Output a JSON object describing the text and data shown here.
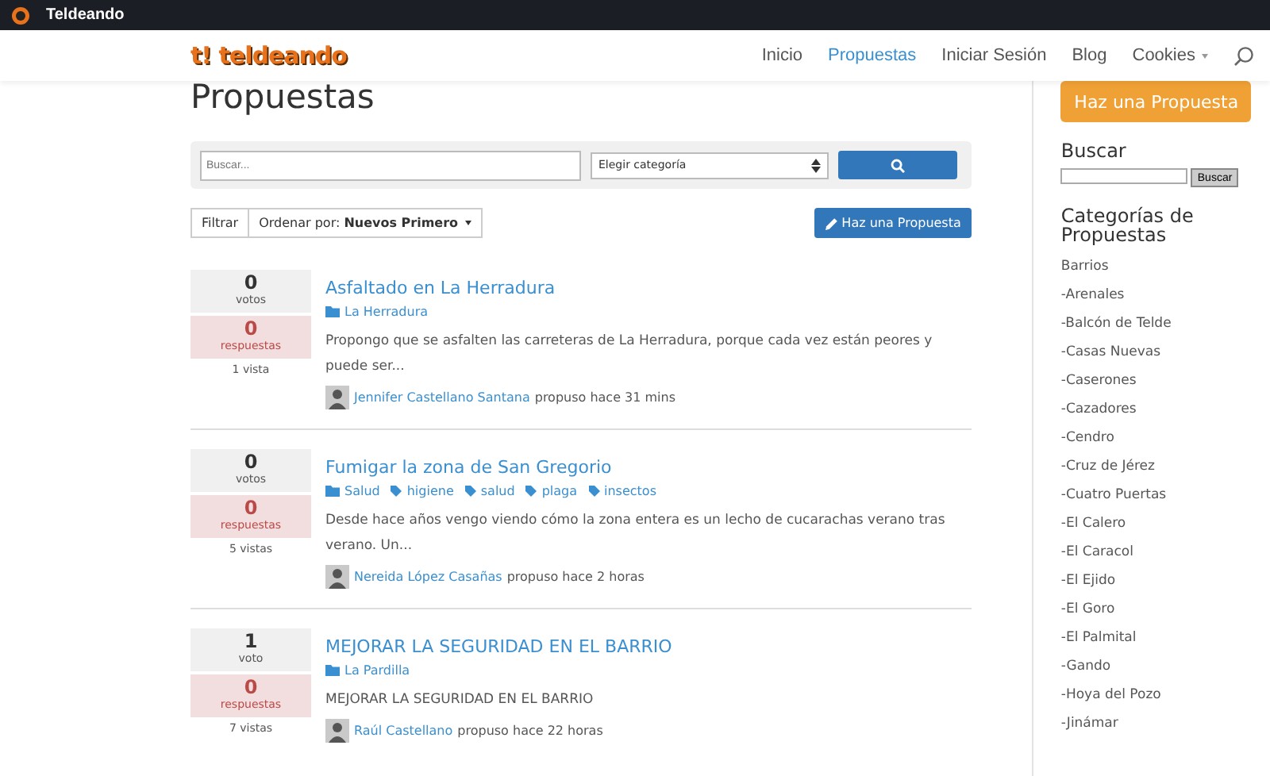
{
  "window": {
    "title": "Teldeando"
  },
  "header": {
    "logo": "t! teldeando",
    "nav": [
      {
        "label": "Inicio",
        "selected": false,
        "dropdown": false
      },
      {
        "label": "Propuestas",
        "selected": true,
        "dropdown": false
      },
      {
        "label": "Iniciar Sesión",
        "selected": false,
        "dropdown": false
      },
      {
        "label": "Blog",
        "selected": false,
        "dropdown": false
      },
      {
        "label": "Cookies",
        "selected": false,
        "dropdown": true
      }
    ]
  },
  "page": {
    "title": "Propuestas",
    "filter_bar": {
      "search_placeholder": "Buscar...",
      "category_select": "Elegir categoría"
    },
    "toolbar": {
      "filter": "Filtrar",
      "sort_label": "Ordenar por:",
      "sort_value": "Nuevos Primero",
      "new_button": "Haz una Propuesta"
    },
    "proposals": [
      {
        "votes": "0",
        "votes_label": "votos",
        "answers": "0",
        "answers_label": "respuestas",
        "views": "1 vista",
        "title": "Asfaltado en La Herradura",
        "terms": [
          {
            "kind": "category",
            "label": "La Herradura"
          }
        ],
        "excerpt": "Propongo que se asfalten las carreteras de La Herradura, porque cada vez están peores y puede ser...",
        "author": "Jennifer Castellano Santana",
        "meta": "propuso hace 31 mins"
      },
      {
        "votes": "0",
        "votes_label": "votos",
        "answers": "0",
        "answers_label": "respuestas",
        "views": "5 vistas",
        "title": "Fumigar la zona de San Gregorio",
        "terms": [
          {
            "kind": "category",
            "label": "Salud"
          },
          {
            "kind": "tag",
            "label": "higiene"
          },
          {
            "kind": "tag",
            "label": "salud"
          },
          {
            "kind": "tag",
            "label": "plaga"
          },
          {
            "kind": "tag",
            "label": "insectos"
          }
        ],
        "excerpt": "Desde hace años vengo viendo cómo la zona entera es un lecho de cucarachas verano tras verano. Un...",
        "author": "Nereida López Casañas",
        "meta": "propuso hace 2 horas"
      },
      {
        "votes": "1",
        "votes_label": "voto",
        "answers": "0",
        "answers_label": "respuestas",
        "views": "7 vistas",
        "title": "MEJORAR LA SEGURIDAD EN EL BARRIO",
        "terms": [
          {
            "kind": "category",
            "label": "La Pardilla"
          }
        ],
        "excerpt": "MEJORAR LA SEGURIDAD EN EL BARRIO",
        "author": "Raúl Castellano",
        "meta": "propuso hace 22 horas"
      }
    ]
  },
  "sidebar": {
    "cta": "Haz una Propuesta",
    "search_title": "Buscar",
    "search_button": "Buscar",
    "categories_title": "Categorías de Propuestas",
    "categories": [
      "Barrios",
      "-Arenales",
      "-Balcón de Telde",
      "-Casas Nuevas",
      "-Caserones",
      "-Cazadores",
      "-Cendro",
      "-Cruz de Jérez",
      "-Cuatro Puertas",
      "-El Calero",
      "-El Caracol",
      "-El Ejido",
      "-El Goro",
      "-El Palmital",
      "-Gando",
      "-Hoya del Pozo",
      "-Jinámar"
    ]
  }
}
